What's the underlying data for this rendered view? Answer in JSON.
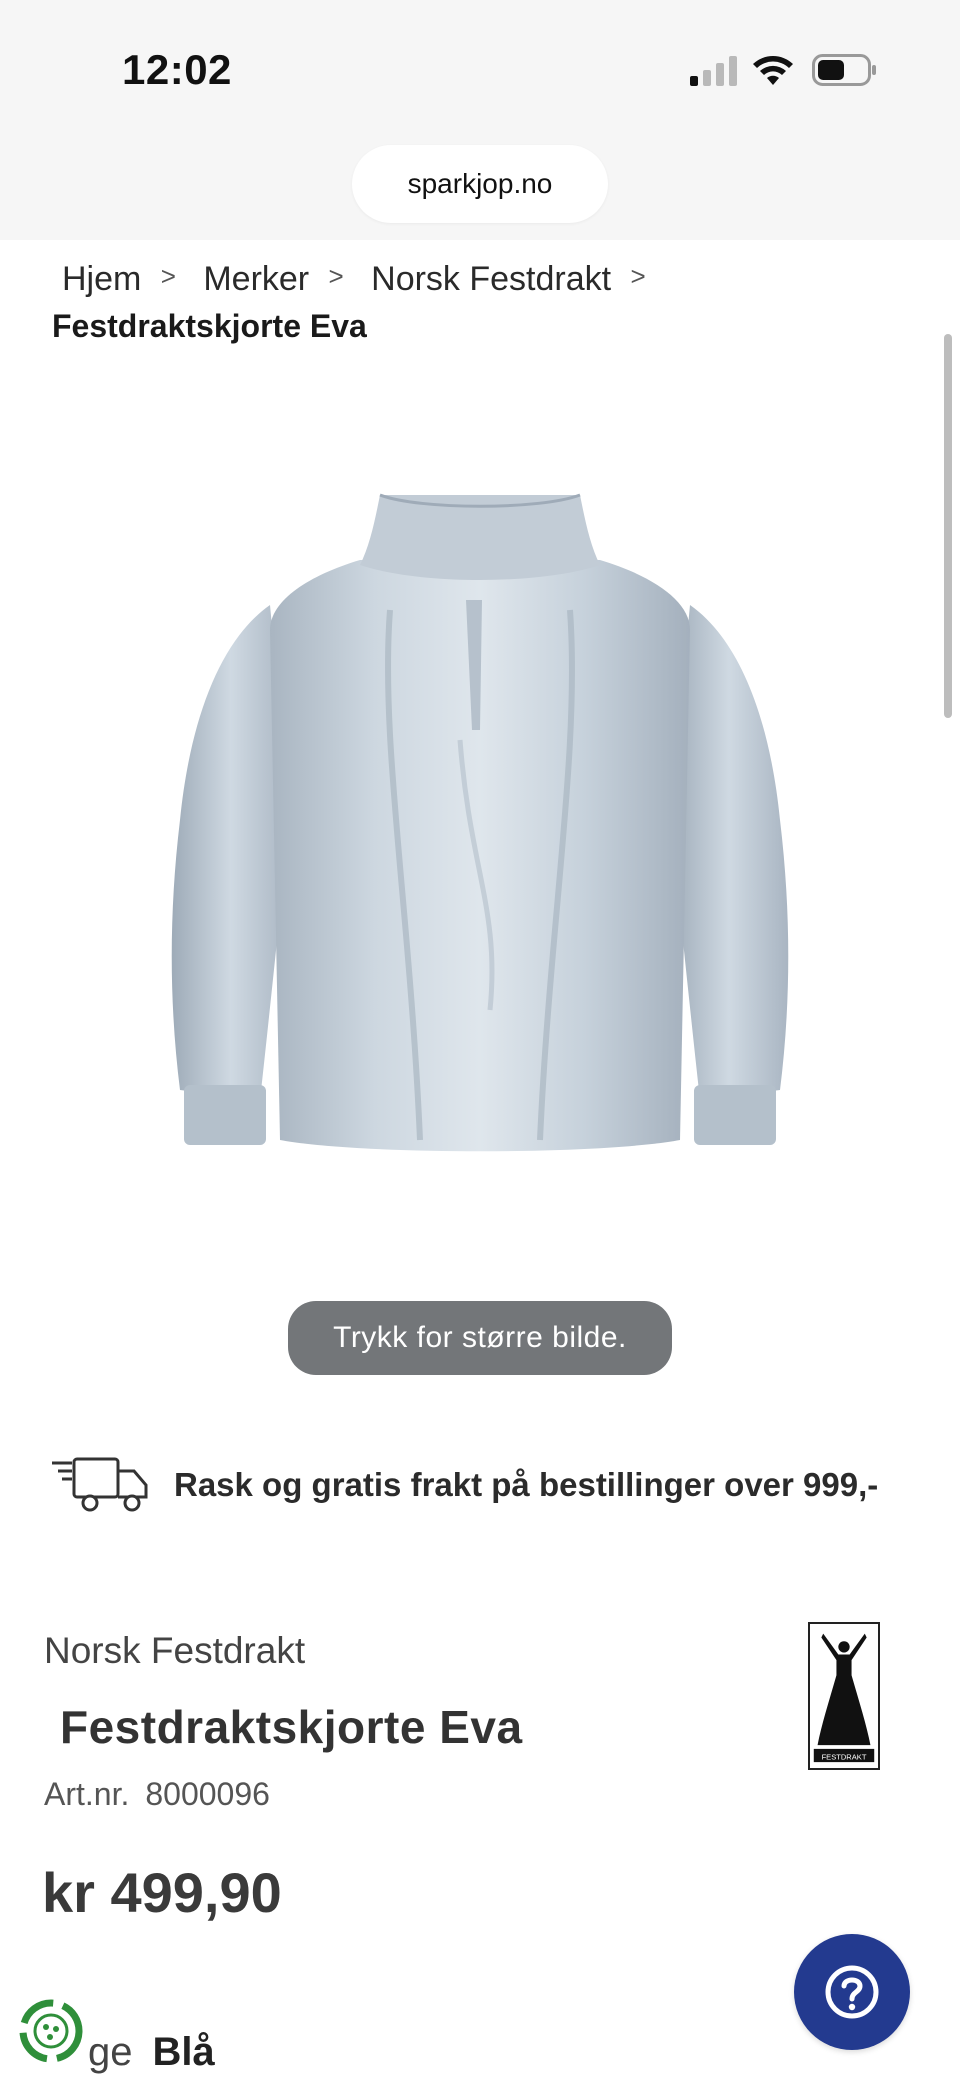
{
  "status_bar": {
    "time": "12:02"
  },
  "browser": {
    "url": "sparkjop.no"
  },
  "breadcrumb": {
    "items": [
      "Hjem",
      "Merker",
      "Norsk Festdrakt"
    ],
    "current": "Festdraktskjorte Eva"
  },
  "gallery": {
    "enlarge_hint": "Trykk for større bilde."
  },
  "shipping": {
    "text": "Rask og gratis frakt på bestillinger over 999,-"
  },
  "product": {
    "brand": "Norsk Festdrakt",
    "title": "Festdraktskjorte Eva",
    "artnr_label": "Art.nr.",
    "artnr_value": "8000096",
    "price": "kr 499,90",
    "color_label": "ge",
    "color_value": "Blå",
    "logo_text": "FESTDRAKT"
  },
  "colors": {
    "accent": "#233a8f",
    "shirt": "#c9d4de",
    "recycle_green": "#2f8f3a"
  },
  "icons": [
    "signal-icon",
    "wifi-icon",
    "battery-icon",
    "chevron-right-icon",
    "truck-icon",
    "recycle-icon",
    "help-icon"
  ]
}
